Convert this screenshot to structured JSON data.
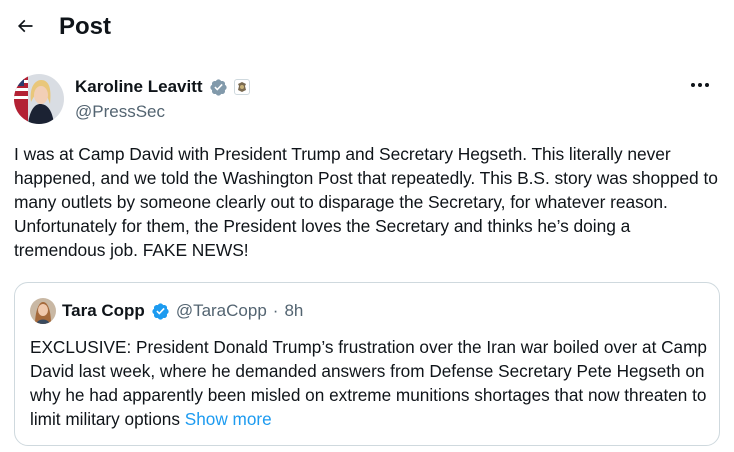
{
  "header": {
    "title": "Post",
    "back_icon": "arrow-left-icon"
  },
  "post": {
    "author": {
      "display_name": "Karoline Leavitt",
      "handle": "@PressSec",
      "verified_badge": "gray-check-badge-icon",
      "affiliation_badge": "government-seal-icon"
    },
    "more_icon": "more-dots-icon",
    "text": "I was at Camp David with President Trump and Secretary Hegseth. This literally never happened, and we told the Washington Post that repeatedly. This B.S. story was shopped to many outlets by someone clearly out to disparage the Secretary, for whatever reason. Unfortunately for them, the President loves the Secretary and thinks he’s doing a tremendous job. FAKE NEWS!"
  },
  "quoted_post": {
    "display_name": "Tara Copp",
    "verified_badge": "blue-check-badge-icon",
    "handle": "@TaraCopp",
    "separator": "·",
    "time": "8h",
    "text": "EXCLUSIVE: President Donald Trump’s frustration over the Iran war boiled over at Camp David last week, where he demanded answers from Defense Secretary Pete Hegseth on why he had apparently been misled on extreme munitions shortages that now threaten to limit military options",
    "show_more": "Show more"
  },
  "colors": {
    "text": "#0f1419",
    "secondary": "#536471",
    "link": "#1d9bf0",
    "border": "#cfd9de",
    "gray_badge": "#829aab"
  }
}
